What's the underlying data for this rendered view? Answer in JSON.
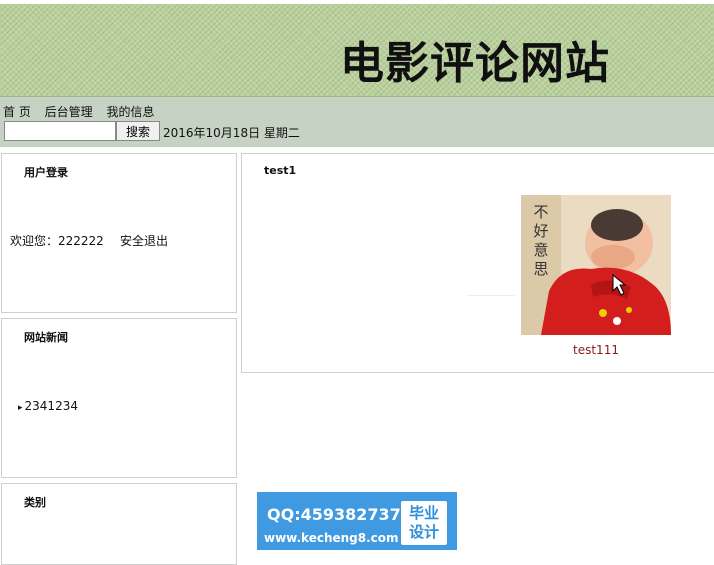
{
  "header": {
    "site_title": "电影评论网站"
  },
  "nav": {
    "items": [
      {
        "label": "首 页"
      },
      {
        "label": "后台管理"
      },
      {
        "label": "我的信息"
      }
    ]
  },
  "search": {
    "value": "",
    "placeholder": "",
    "button_label": "搜索"
  },
  "date_text": "2016年10月18日 星期二",
  "sidebar": {
    "login": {
      "title": "用户登录",
      "welcome": "欢迎您：222222",
      "logout_label": "安全退出"
    },
    "news": {
      "title": "网站新闻",
      "items": [
        {
          "label": "2341234"
        }
      ]
    },
    "category": {
      "title": "类别"
    }
  },
  "main": {
    "title": "test1",
    "movies": [
      {
        "caption": "test111",
        "poster_text": "不好意思"
      }
    ]
  },
  "watermark": {
    "qq": "QQ:459382737",
    "site": "www.kecheng8.com",
    "badge_line1": "毕业",
    "badge_line2": "设计"
  },
  "colors": {
    "banner": "#b9cf9c",
    "toolbar": "#c6d2c4",
    "caption": "#8a1a1a",
    "watermark": "#3f9ae2"
  }
}
